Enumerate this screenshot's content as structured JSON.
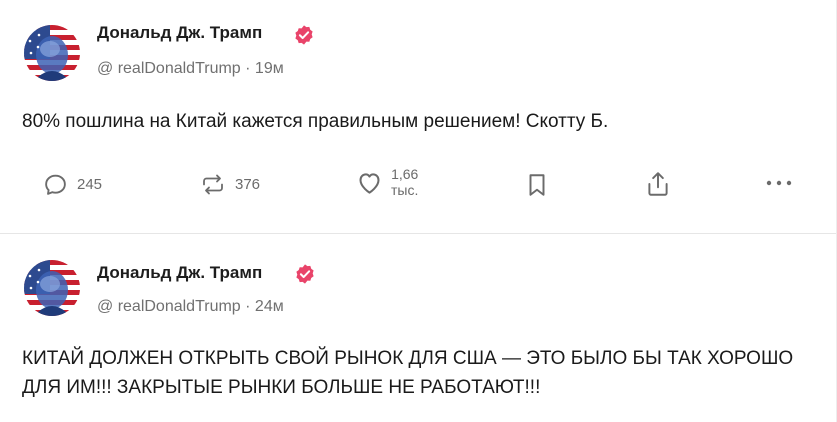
{
  "posts": [
    {
      "author": "Дональд Дж. Трамп",
      "handle": "@ realDonaldTrump · 19м",
      "text": "80% пошлина на Китай кажется правильным решением! Скотту Б.",
      "actions": {
        "reply_count": "245",
        "repost_count": "376",
        "like_count_line1": "1,66",
        "like_count_line2": "тыс."
      }
    },
    {
      "author": "Дональд Дж. Трамп",
      "handle": "@ realDonaldTrump · 24м",
      "text": "КИТАЙ ДОЛЖЕН ОТКРЫТЬ СВОЙ РЫНОК ДЛЯ США — ЭТО БЫЛО БЫ ТАК ХОРОШО ДЛЯ ИМ!!! ЗАКРЫТЫЕ РЫНКИ БОЛЬШЕ НЕ РАБОТАЮТ!!!"
    }
  ],
  "icons": {
    "verified": "verified-badge-icon",
    "reply": "reply-icon",
    "repost": "repost-icon",
    "like": "heart-icon",
    "bookmark": "bookmark-icon",
    "share": "share-icon",
    "more": "more-icon"
  },
  "colors": {
    "verified_badge": "#e9446a",
    "text": "#1a1a1a",
    "muted": "#707070",
    "background": "#ffffff"
  }
}
